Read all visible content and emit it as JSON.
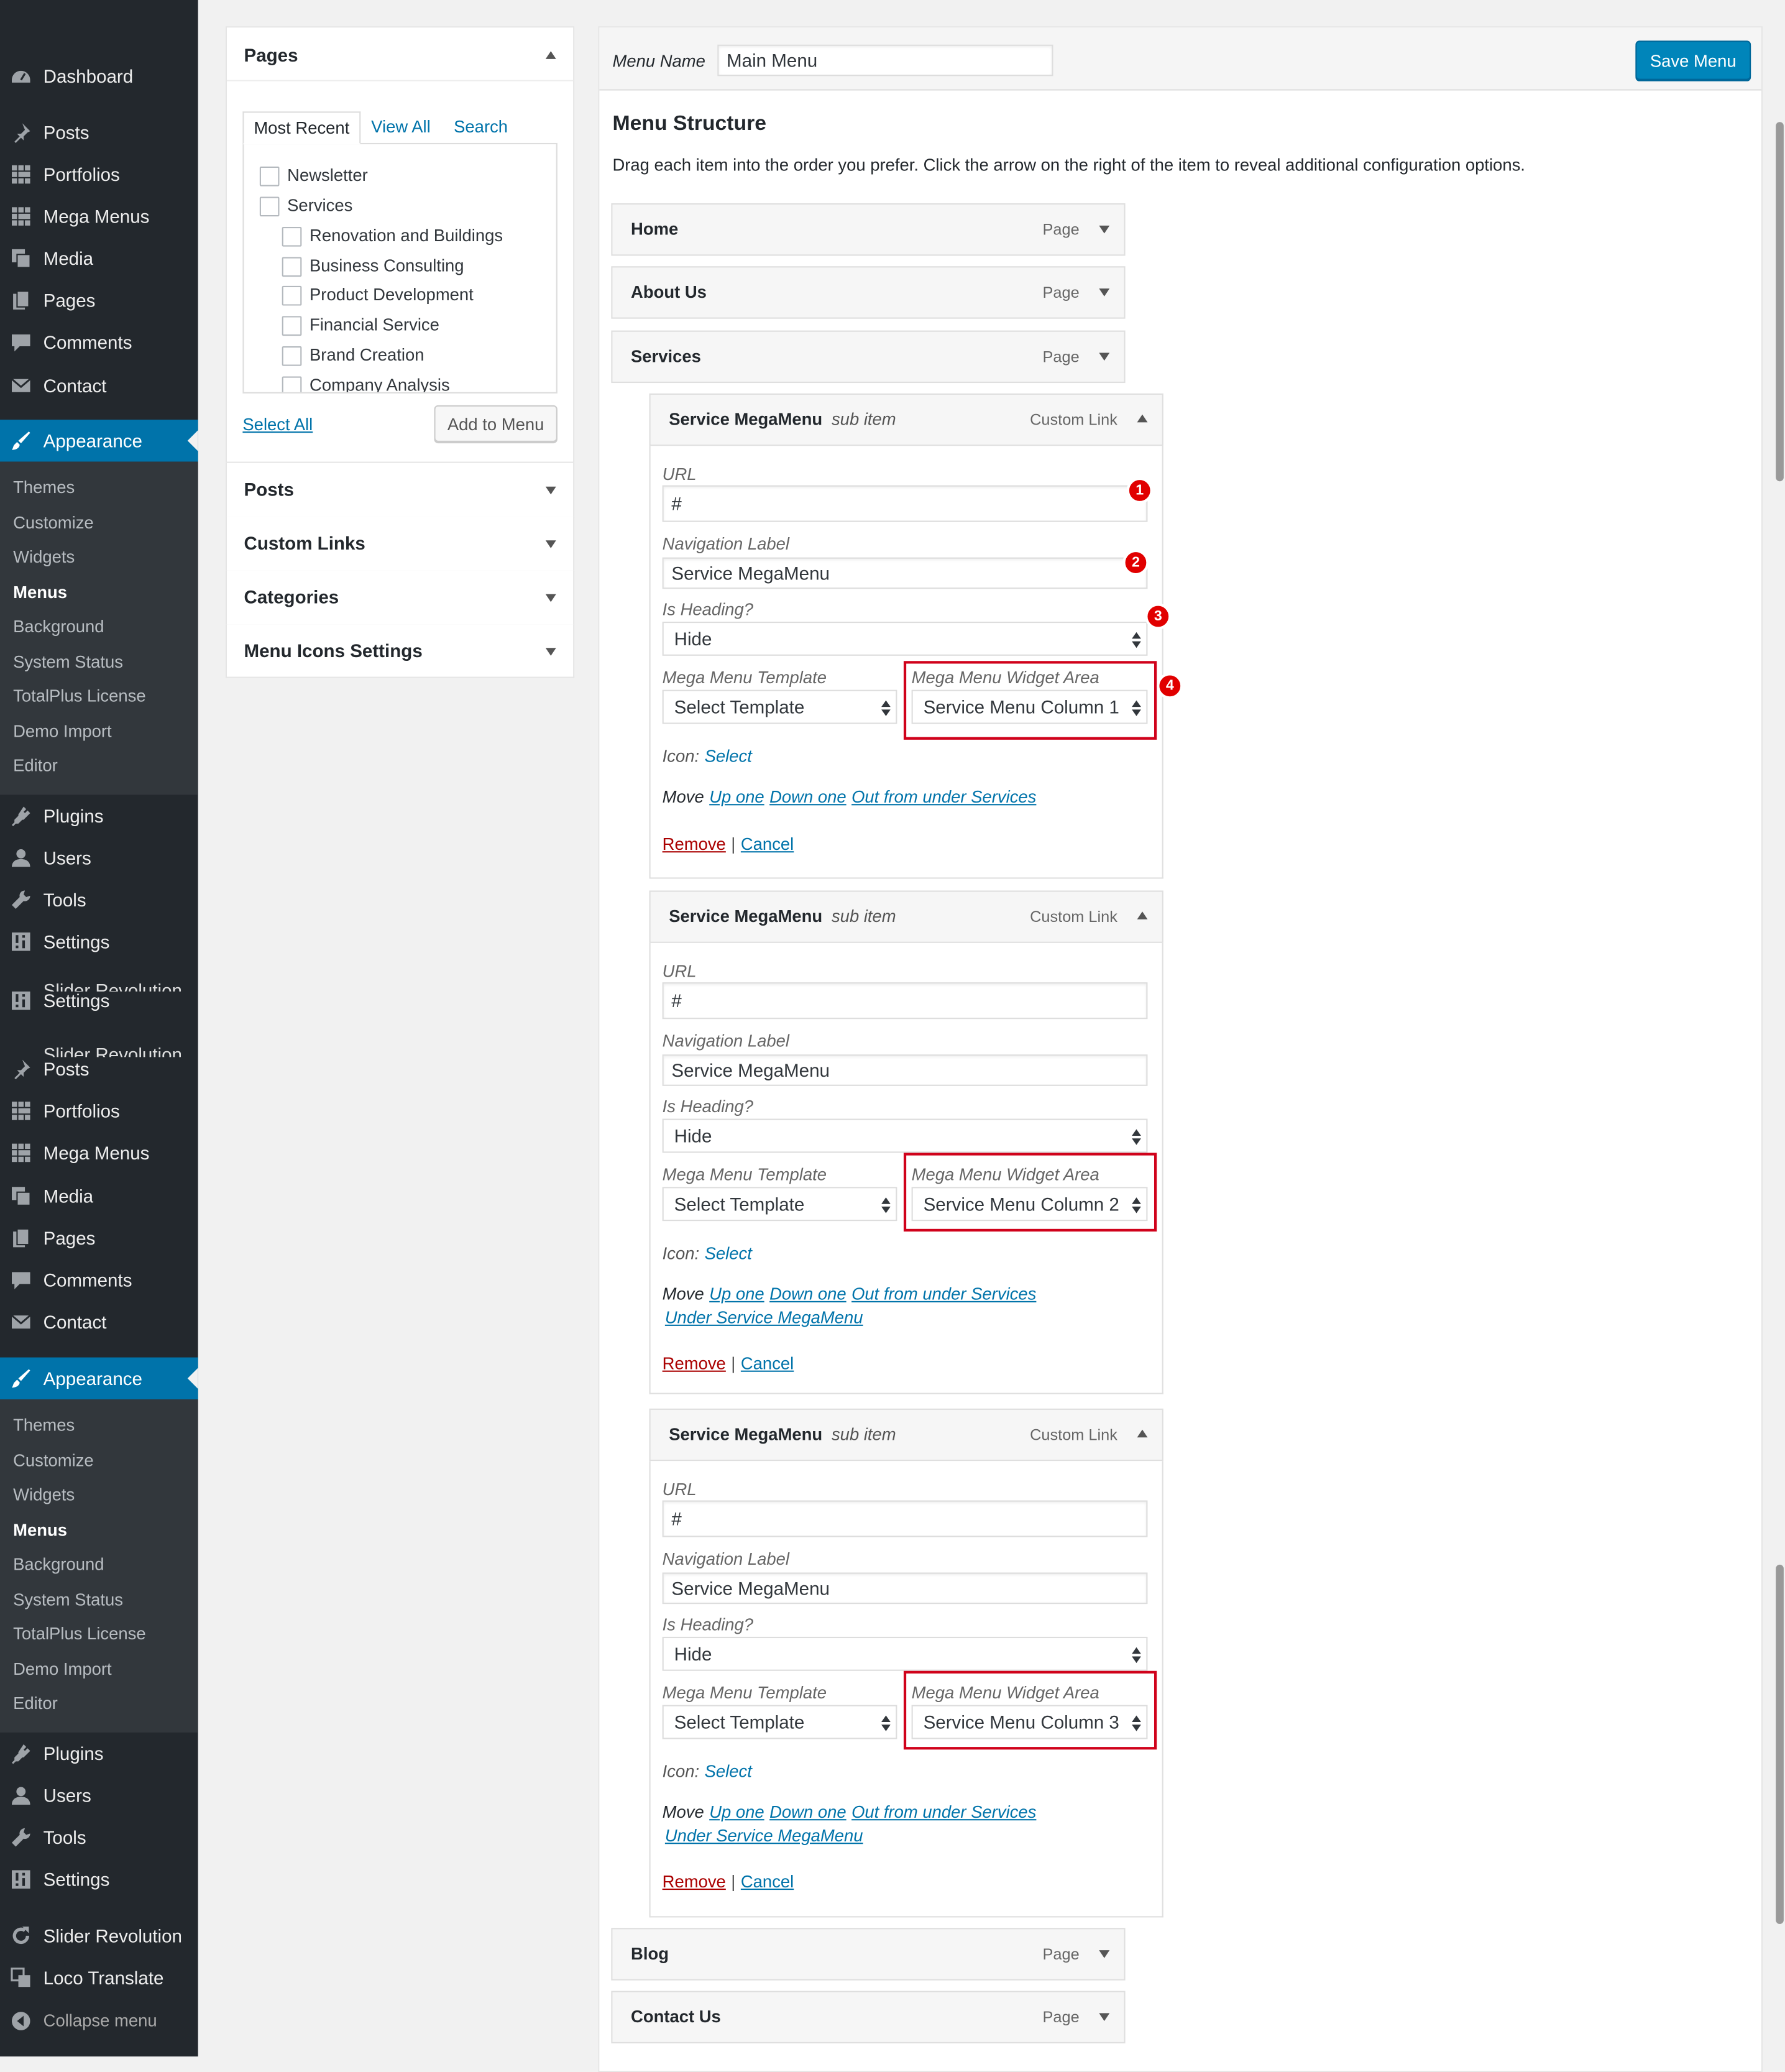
{
  "sidebar": {
    "group1": [
      "Dashboard",
      "Posts",
      "Portfolios",
      "Mega Menus",
      "Media",
      "Pages",
      "Comments",
      "Contact"
    ],
    "appearance": "Appearance",
    "submenu": [
      "Themes",
      "Customize",
      "Widgets",
      "Menus",
      "Background",
      "System Status",
      "TotalPlus License",
      "Demo Import",
      "Editor"
    ],
    "group2": [
      "Plugins",
      "Users",
      "Tools",
      "Settings"
    ],
    "bug_settings": "Settings",
    "bug_slider": "Slider Revolution",
    "bug_posts": "Posts",
    "group3": [
      "Portfolios",
      "Mega Menus",
      "Media",
      "Pages",
      "Comments",
      "Contact"
    ],
    "appearance2": "Appearance",
    "submenu2": [
      "Themes",
      "Customize",
      "Widgets",
      "Menus",
      "Background",
      "System Status",
      "TotalPlus License",
      "Demo Import",
      "Editor"
    ],
    "group4": [
      "Plugins",
      "Users",
      "Tools",
      "Settings"
    ],
    "bottom": [
      "Slider Revolution",
      "Loco Translate"
    ],
    "collapse": "Collapse menu"
  },
  "left": {
    "pages_title": "Pages",
    "tabs": [
      "Most Recent",
      "View All",
      "Search"
    ],
    "checklist": [
      "Newsletter",
      "Services",
      "Renovation and Buildings",
      "Business Consulting",
      "Product Development",
      "Financial Service",
      "Brand Creation",
      "Company Analysis"
    ],
    "select_all": "Select All",
    "add_to_menu": "Add to Menu",
    "sections": [
      "Posts",
      "Custom Links",
      "Categories",
      "Menu Icons Settings"
    ]
  },
  "header": {
    "menu_name_label": "Menu Name",
    "menu_name": "Main Menu",
    "save": "Save Menu"
  },
  "structure": {
    "title": "Menu Structure",
    "desc": "Drag each item into the order you prefer. Click the arrow on the right of the item to reveal additional configuration options."
  },
  "items_top": [
    {
      "title": "Home",
      "type": "Page"
    },
    {
      "title": "About Us",
      "type": "Page"
    },
    {
      "title": "Services",
      "type": "Page"
    }
  ],
  "items_bottom": [
    {
      "title": "Blog",
      "type": "Page"
    },
    {
      "title": "Contact Us",
      "type": "Page"
    }
  ],
  "subitems": [
    {
      "title": "Service MegaMenu",
      "sub": "sub item",
      "type": "Custom Link",
      "url": "#",
      "nav_label": "Service MegaMenu",
      "heading": "Hide",
      "template": "Select Template",
      "widget": "Service Menu Column 1",
      "move_under": ""
    },
    {
      "title": "Service MegaMenu",
      "sub": "sub item",
      "type": "Custom Link",
      "url": "#",
      "nav_label": "Service MegaMenu",
      "heading": "Hide",
      "template": "Select Template",
      "widget": "Service Menu Column 2",
      "move_under": "Under Service MegaMenu"
    },
    {
      "title": "Service MegaMenu",
      "sub": "sub item",
      "type": "Custom Link",
      "url": "#",
      "nav_label": "Service MegaMenu",
      "heading": "Hide",
      "template": "Select Template",
      "widget": "Service Menu Column 3",
      "move_under": "Under Service MegaMenu"
    }
  ],
  "labels": {
    "url": "URL",
    "nav_label": "Navigation Label",
    "is_heading": "Is Heading?",
    "template": "Mega Menu Template",
    "widget": "Mega Menu Widget Area",
    "icon": "Icon:",
    "icon_select": "Select",
    "move": "Move",
    "up": "Up one",
    "down": "Down one",
    "out": "Out from under Services",
    "remove": "Remove",
    "sep": "|",
    "cancel": "Cancel"
  },
  "badges": [
    "1",
    "2",
    "3",
    "4"
  ],
  "colors": {
    "sidebar": "#23282d",
    "submenu": "#32373c",
    "active": "#0073aa",
    "highlight": "#d0021b",
    "link": "#0073aa"
  }
}
